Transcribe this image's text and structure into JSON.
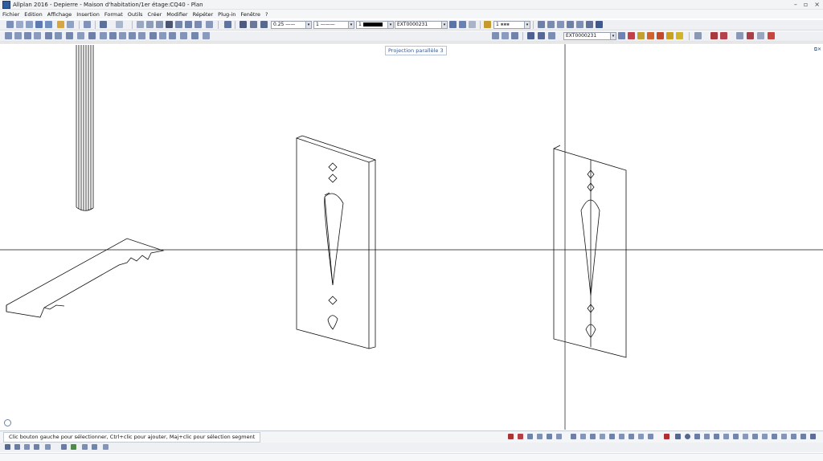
{
  "window": {
    "title": "Allplan 2016 - Depierre - Maison d'habitation/1er étage:CQ40 - Plan"
  },
  "menu": {
    "items": [
      "Fichier",
      "Edition",
      "Affichage",
      "Insertion",
      "Format",
      "Outils",
      "Créer",
      "Modifier",
      "Répéter",
      "Plug-in",
      "Fenêtre",
      "?"
    ]
  },
  "toolbar": {
    "pen_thickness": "0.25",
    "line_type": "1",
    "color_number": "1",
    "layer": "EXT0000231",
    "hatch_number": "1"
  },
  "toolbar2": {
    "layer": "EXT0000231"
  },
  "viewport": {
    "label": "Projection parallèle 3"
  },
  "status": {
    "message": "Clic bouton gauche pour sélectionner, Ctrl+clic pour ajouter, Maj+clic pour sélection segment"
  },
  "icons": {
    "app": "allplan-icon",
    "window_controls": [
      "minimize-icon",
      "restore-icon",
      "close-icon"
    ]
  }
}
